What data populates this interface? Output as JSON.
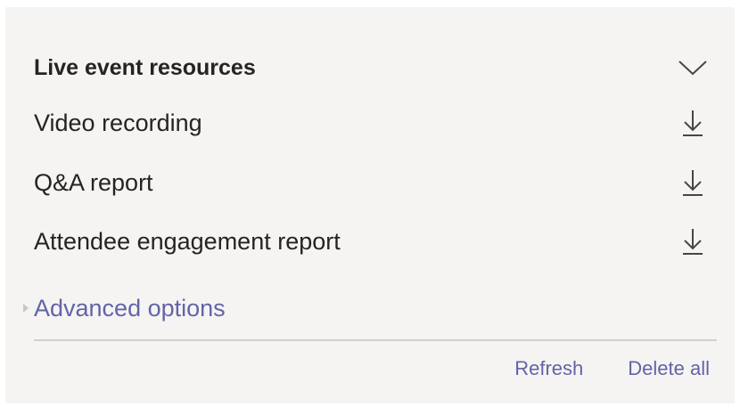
{
  "panel": {
    "title": "Live event resources",
    "collapse_icon": "chevron-down-icon",
    "download_icon": "download-icon",
    "items": [
      {
        "label": "Video recording"
      },
      {
        "label": "Q&A report"
      },
      {
        "label": "Attendee engagement report"
      }
    ],
    "advanced_options_label": "Advanced options",
    "footer": {
      "refresh_label": "Refresh",
      "delete_all_label": "Delete all"
    }
  },
  "colors": {
    "panel_background": "#f5f4f3",
    "text": "#252423",
    "accent": "#6264a7",
    "divider": "#d2d0ce",
    "icon": "#484644"
  }
}
